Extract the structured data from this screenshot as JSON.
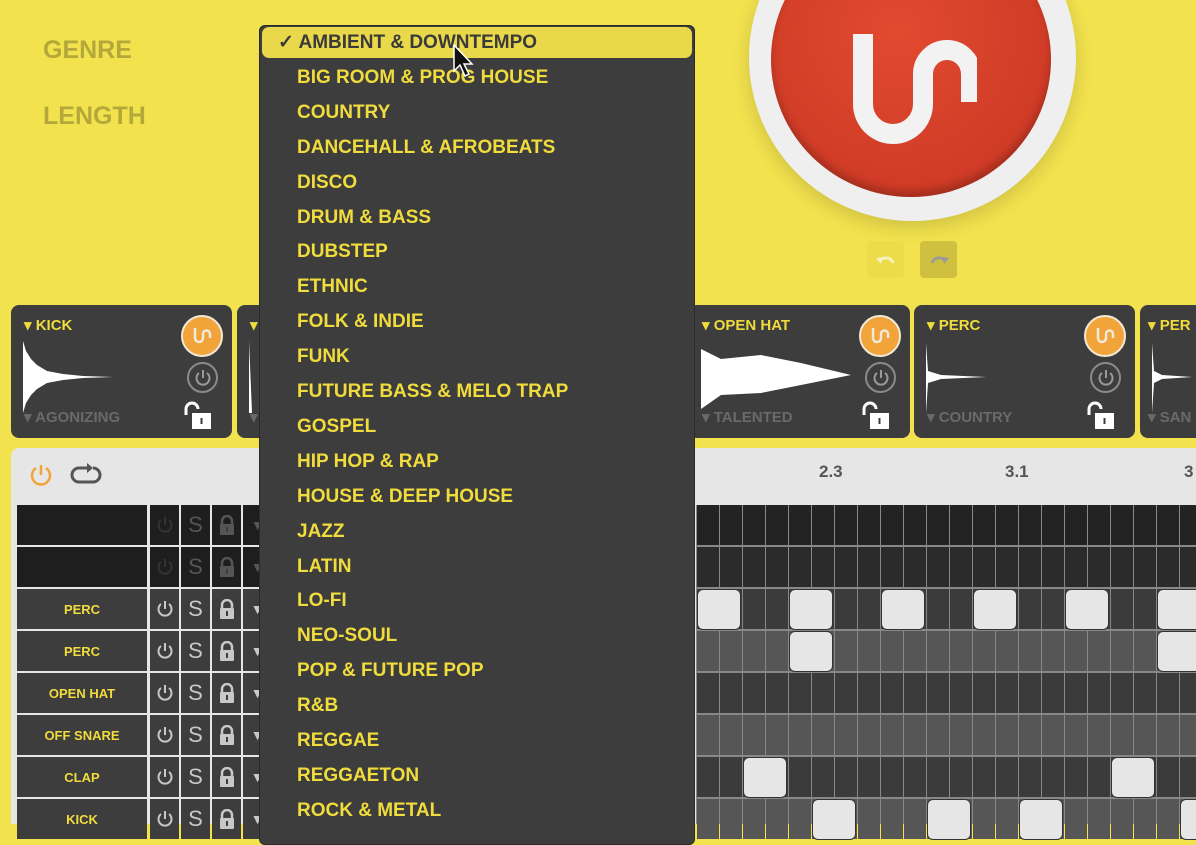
{
  "labels": {
    "genre": "GENRE",
    "length": "LENGTH"
  },
  "colors": {
    "background": "#f2e24e",
    "accent_text": "#f0dc3c",
    "panel": "#3d3d3d",
    "generate_button": "#d9412b",
    "sample_button": "#f0a43a",
    "note": "#e6e6e6"
  },
  "icons": {
    "big_button": "unison-logo-icon",
    "undo": "undo-icon",
    "redo": "redo-icon",
    "sample_gen": "unison-logo-icon",
    "power": "power-icon",
    "lock": "lock-open-icon",
    "loop": "loop-icon",
    "cursor": "mouse-pointer-icon"
  },
  "genre_dropdown": {
    "selected": "AMBIENT & DOWNTEMPO",
    "check": "✓",
    "options": [
      "AMBIENT & DOWNTEMPO",
      "BIG ROOM & PROG HOUSE",
      "COUNTRY",
      "DANCEHALL & AFROBEATS",
      "DISCO",
      "DRUM & BASS",
      "DUBSTEP",
      "ETHNIC",
      "FOLK & INDIE",
      "FUNK",
      "FUTURE BASS & MELO TRAP",
      "GOSPEL",
      "HIP HOP & RAP",
      "HOUSE & DEEP HOUSE",
      "JAZZ",
      "LATIN",
      "LO-FI",
      "NEO-SOUL",
      "POP & FUTURE POP",
      "R&B",
      "REGGAE",
      "REGGAETON",
      "ROCK & METAL"
    ]
  },
  "sample_cards": [
    {
      "name": "KICK",
      "sub": "AGONIZING"
    },
    {
      "name": "",
      "sub": ""
    },
    {
      "name": "OPEN HAT",
      "sub": "TALENTED"
    },
    {
      "name": "PERC",
      "sub": "COUNTRY"
    },
    {
      "name": "PER",
      "sub": "SAN"
    }
  ],
  "bar_markers": [
    "2.3",
    "3.1",
    "3"
  ],
  "solo_label": "S",
  "tracks": [
    {
      "name": "",
      "enabled": false,
      "notes": []
    },
    {
      "name": "",
      "enabled": false,
      "notes": []
    },
    {
      "name": "PERC",
      "enabled": true,
      "notes": [
        0,
        4,
        8,
        12,
        16,
        20
      ]
    },
    {
      "name": "PERC",
      "enabled": true,
      "notes": [
        4,
        20
      ]
    },
    {
      "name": "OPEN HAT",
      "enabled": true,
      "notes": []
    },
    {
      "name": "OFF SNARE",
      "enabled": true,
      "notes": []
    },
    {
      "name": "CLAP",
      "enabled": true,
      "notes": [
        2,
        18
      ]
    },
    {
      "name": "KICK",
      "enabled": true,
      "notes": [
        5,
        10,
        14,
        21
      ]
    }
  ]
}
